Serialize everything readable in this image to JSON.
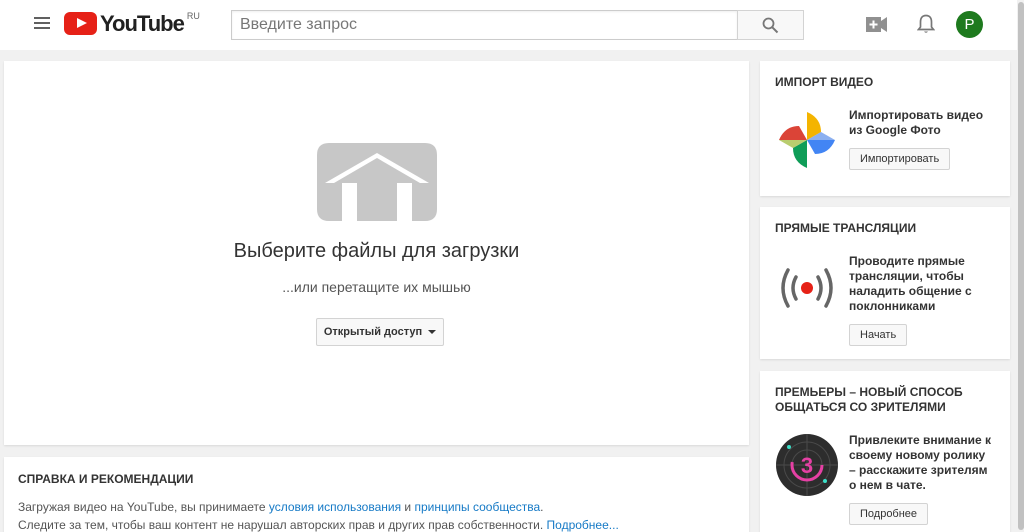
{
  "header": {
    "logo_text": "YouTube",
    "logo_region": "RU",
    "search_placeholder": "Введите запрос",
    "avatar_letter": "P"
  },
  "upload": {
    "title": "Выберите файлы для загрузки",
    "subtitle": "...или перетащите их мышью",
    "privacy_label": "Открытый доступ"
  },
  "help": {
    "title": "СПРАВКА И РЕКОМЕНДАЦИИ",
    "line1_prefix": "Загружая видео на YouTube, вы принимаете ",
    "terms_link": "условия использования",
    "and": " и ",
    "guidelines_link": "принципы сообщества",
    "line1_suffix": ".",
    "line2_prefix": "Следите за тем, чтобы ваш контент не нарушал авторских прав и других прав собственности. ",
    "more_link": "Подробнее..."
  },
  "import": {
    "title": "ИМПОРТ ВИДЕО",
    "description": "Импортировать видео из Google Фото",
    "button": "Импортировать"
  },
  "live": {
    "title": "ПРЯМЫЕ ТРАНСЛЯЦИИ",
    "description": "Проводите прямые трансляции, чтобы наладить общение с поклонниками",
    "button": "Начать"
  },
  "premieres": {
    "title": "ПРЕМЬЕРЫ – НОВЫЙ СПОСОБ ОБЩАТЬСЯ СО ЗРИТЕЛЯМИ",
    "description": "Привлеките внимание к своему новому ролику – расскажите зрителям о нем в чате.",
    "button": "Подробнее",
    "badge_number": "3"
  },
  "colors": {
    "brand_red": "#e62117",
    "avatar_green": "#1e7a1e",
    "link_blue": "#167ac6"
  }
}
